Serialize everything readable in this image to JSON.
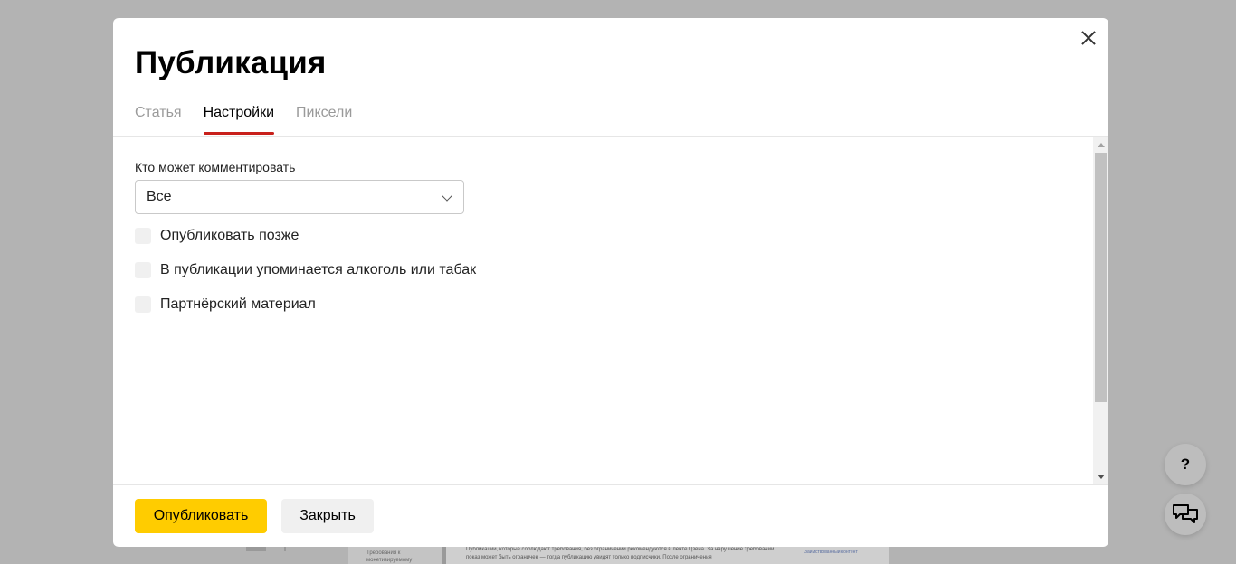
{
  "modal": {
    "title": "Публикация",
    "close_icon": "close-icon",
    "tabs": [
      {
        "label": "Статья",
        "active": false
      },
      {
        "label": "Настройки",
        "active": true
      },
      {
        "label": "Пиксели",
        "active": false
      }
    ],
    "comments": {
      "label": "Кто может комментировать",
      "selected": "Все"
    },
    "checkboxes": [
      {
        "label": "Опубликовать позже",
        "checked": false
      },
      {
        "label": "В публикации упоминается алкоголь или табак",
        "checked": false
      },
      {
        "label": "Партнёрский материал",
        "checked": false
      }
    ],
    "footer": {
      "publish_label": "Опубликовать",
      "close_label": "Закрыть"
    }
  },
  "floating": {
    "help_label": "?",
    "chat_icon": "chat-icon"
  },
  "background": {
    "left_text": "Требования к монетизируемому",
    "main_text": "Публикации, которые соблюдают требования, без ограничений рекомендуются в ленте Дзена. За нарушение требований показ может быть ограничен — тогда публикацию увидят только подписчики. После ограничения",
    "right_text": "Заимствованный контент"
  },
  "colors": {
    "accent_tab": "#c8201b",
    "primary_button": "#ffcc00",
    "overlay": "#b3b3b3"
  }
}
